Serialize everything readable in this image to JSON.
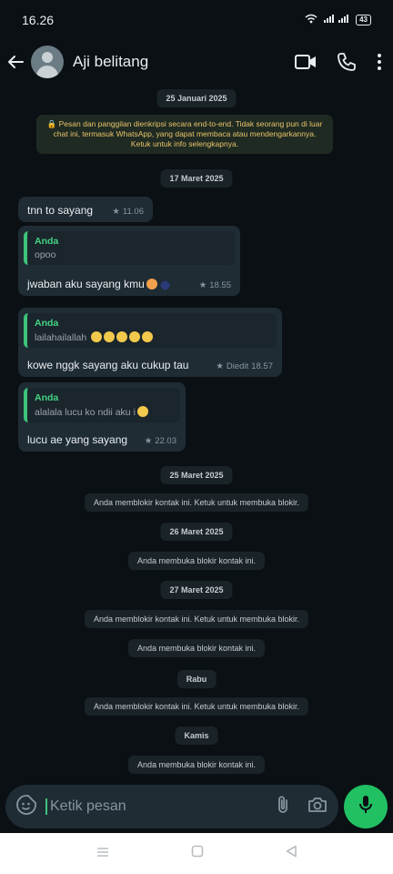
{
  "status_bar": {
    "time": "16.26",
    "signal": "≉ .∥ .∥",
    "battery": "43"
  },
  "header": {
    "contact_name": "Aji belitang"
  },
  "chat": {
    "date_1": "25 Januari 2025",
    "encryption_notice": "🔒 Pesan dan panggilan dienkripsi secara end-to-end. Tidak seorang pun di luar chat ini, termasuk WhatsApp, yang dapat membaca atau mendengarkannya. Ketuk untuk info selengkapnya.",
    "date_2": "17 Maret 2025",
    "messages": [
      {
        "text": "tnn to sayang",
        "time": "11.06"
      },
      {
        "quote_author": "Anda",
        "quote_text": "opoo",
        "text": "jwaban aku sayang kmu",
        "time": "18.55"
      },
      {
        "quote_author": "Anda",
        "quote_text": "lailahailallah",
        "text": "kowe nggk sayang aku cukup tau",
        "time": "18.57",
        "edited": "Diedit"
      },
      {
        "quote_author": "Anda",
        "quote_text": "alalala lucu ko ndii aku i",
        "text": "lucu ae yang sayang",
        "time": "22.03"
      }
    ],
    "date_3": "25 Maret 2025",
    "sys_1": "Anda memblokir kontak ini. Ketuk untuk membuka blokir.",
    "date_4": "26 Maret 2025",
    "sys_2": "Anda membuka blokir kontak ini.",
    "date_5": "27 Maret 2025",
    "sys_3": "Anda memblokir kontak ini. Ketuk untuk membuka blokir.",
    "sys_4": "Anda membuka blokir kontak ini.",
    "date_6": "Rabu",
    "sys_5": "Anda memblokir kontak ini. Ketuk untuk membuka blokir.",
    "date_7": "Kamis",
    "sys_6": "Anda membuka blokir kontak ini."
  },
  "input": {
    "placeholder": "Ketik pesan"
  },
  "icons": {
    "back": "back-arrow-icon",
    "video": "video-call-icon",
    "call": "phone-call-icon",
    "menu": "more-vertical-icon",
    "sticker": "sticker-icon",
    "attach": "attach-icon",
    "camera": "camera-icon",
    "mic": "mic-icon"
  },
  "colors": {
    "accent": "#21c063",
    "bubble": "#1f2c34",
    "background": "#0b1014"
  }
}
